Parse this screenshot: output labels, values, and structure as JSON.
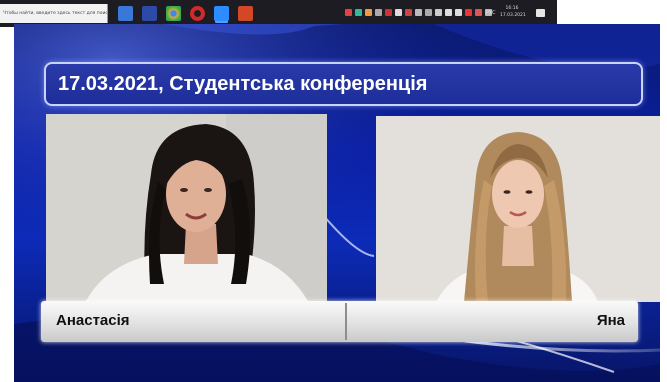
{
  "taskbar": {
    "search_placeholder": "Чтобы найти, введите здесь текст для поиска",
    "language": "РУС",
    "time": "16:16",
    "date": "17.03.2021",
    "pinned_apps": [
      {
        "name": "file-explorer",
        "color": "#3a78d8"
      },
      {
        "name": "store",
        "color": "#4a6fd0"
      },
      {
        "name": "chrome",
        "color": "#d8a020"
      },
      {
        "name": "opera",
        "color": "#d12a2a"
      },
      {
        "name": "zoom",
        "color": "#2d8cff"
      },
      {
        "name": "presentation",
        "color": "#d24726"
      }
    ]
  },
  "slide": {
    "title": "17.03.2021, Студентська конференція",
    "left_participant": "Анастасія",
    "right_participant": "Яна"
  },
  "colors": {
    "background_blue": "#0a1fa3",
    "title_panel": "#1d2e9a",
    "nameplate": "#e2e2e2",
    "taskbar": "#1c1c22"
  }
}
